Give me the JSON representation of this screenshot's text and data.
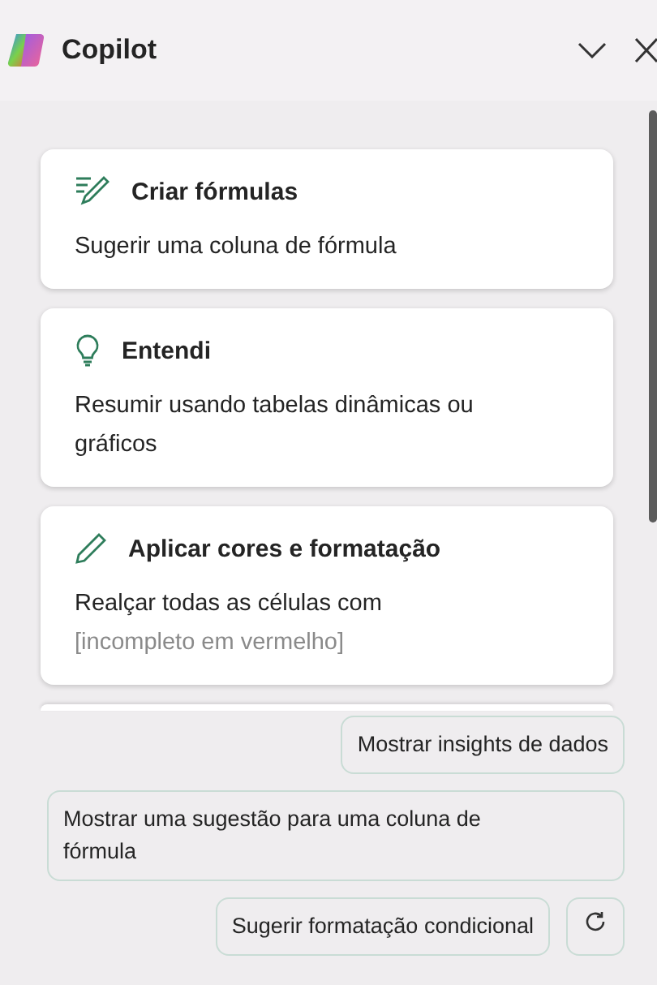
{
  "header": {
    "title": "Copilot"
  },
  "cards": [
    {
      "kind": "formula",
      "title": "Criar fórmulas",
      "description": "Sugerir uma coluna de fórmula"
    },
    {
      "kind": "bulb",
      "title": "Entendi",
      "description": "Resumir usando tabelas dinâmicas ou gráficos"
    },
    {
      "kind": "pencil",
      "title": "Aplicar cores e formatação",
      "description": "Realçar todas as células com",
      "hint": "[incompleto em vermelho]"
    }
  ],
  "suggestions": [
    "Mostrar insights de dados",
    "Mostrar uma sugestão para uma coluna de fórmula",
    "Sugerir formatação condicional"
  ]
}
